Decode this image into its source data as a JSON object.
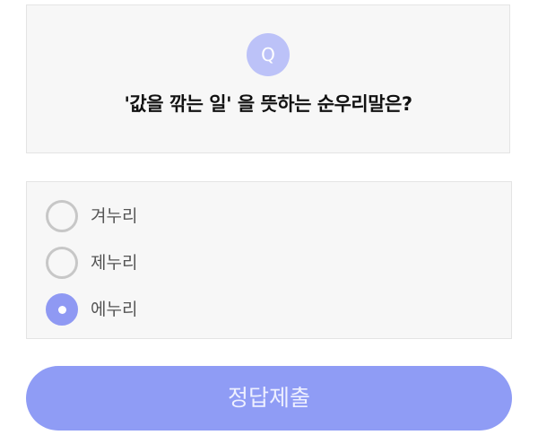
{
  "question": {
    "badge": "Q",
    "text": "'값을 깎는 일' 을 뜻하는 순우리말은?"
  },
  "options": [
    {
      "label": "겨누리",
      "selected": false
    },
    {
      "label": "제누리",
      "selected": false
    },
    {
      "label": "에누리",
      "selected": true
    }
  ],
  "submit": {
    "label": "정답제출"
  },
  "colors": {
    "accent": "#8f9cf5",
    "badge": "#bcc2f8",
    "card_bg": "#f7f7f7",
    "radio_unchecked": "#c7c7c7"
  }
}
